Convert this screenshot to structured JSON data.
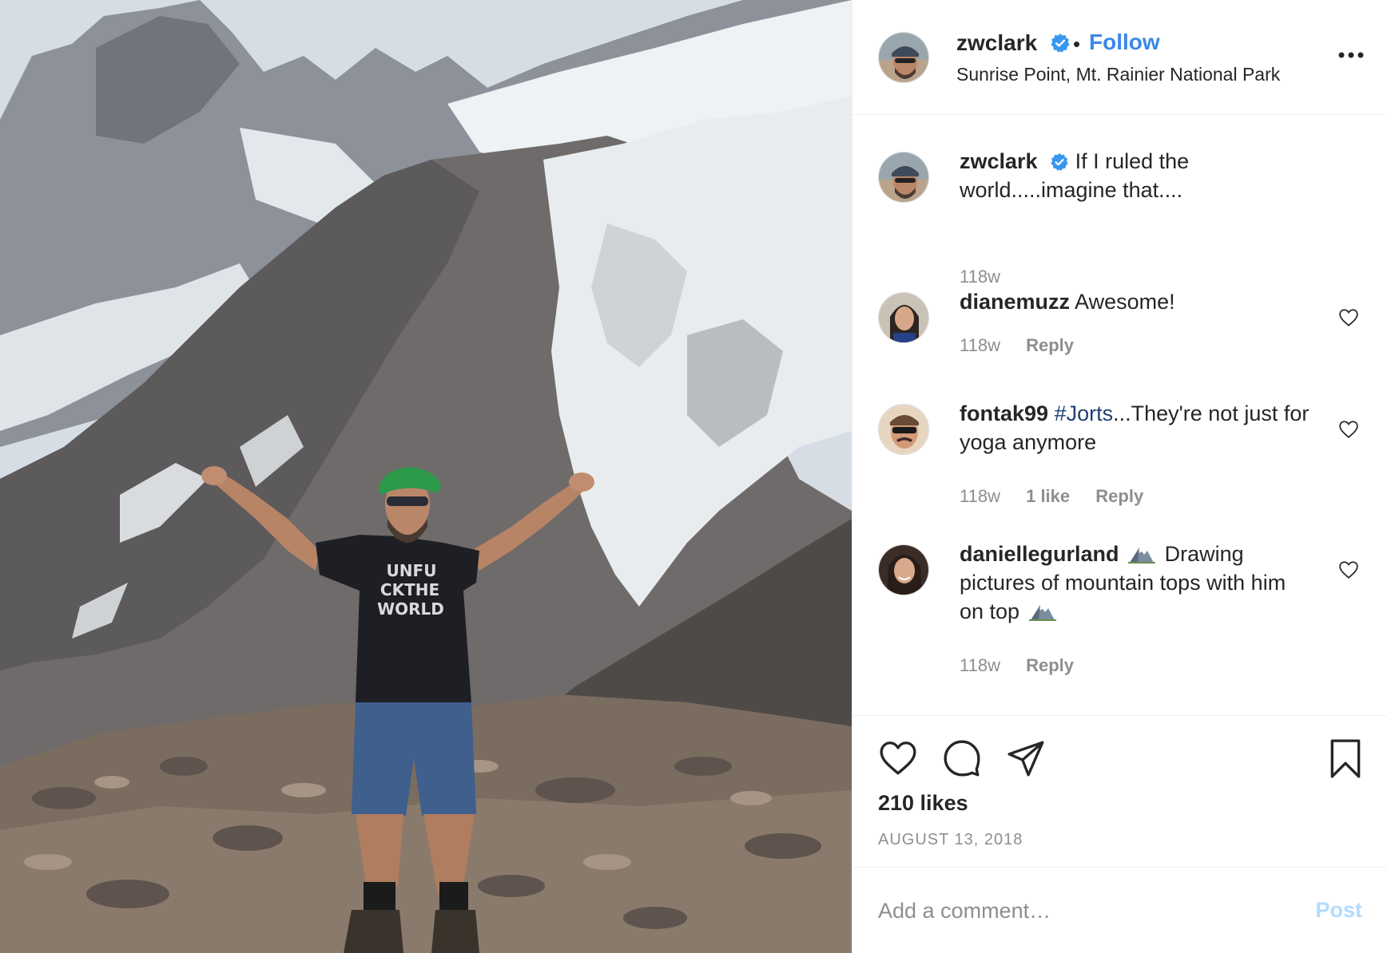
{
  "post": {
    "photo_alt": "",
    "shirt_text_lines": [
      "UNFU",
      "CKTHE",
      "WORLD"
    ]
  },
  "header": {
    "username": "zwclark",
    "separator": "•",
    "follow_label": "Follow",
    "location": "Sunrise Point, Mt. Rainier National Park"
  },
  "caption": {
    "username": "zwclark",
    "text": "If I ruled the world.....imagine that....",
    "time": "118w"
  },
  "comments": [
    {
      "username": "dianemuzz",
      "text": "Awesome!",
      "time": "118w",
      "reply_label": "Reply"
    },
    {
      "username": "fontak99",
      "hashtag": "#Jorts",
      "text": "...They're not just for yoga anymore",
      "time": "118w",
      "likes_label": "1 like",
      "reply_label": "Reply"
    },
    {
      "username": "daniellegurland",
      "text_part1": "Drawing pictures of mountain tops with him on top",
      "time": "118w",
      "reply_label": "Reply"
    }
  ],
  "actions": {
    "likes": "210 likes",
    "date": "AUGUST 13, 2018"
  },
  "add_comment": {
    "placeholder": "Add a comment…",
    "post_label": "Post"
  },
  "colors": {
    "link_blue": "#3b88e8",
    "hashtag": "#1f3f75",
    "muted": "#8e8e8e",
    "post_disabled": "#b3dbff"
  }
}
